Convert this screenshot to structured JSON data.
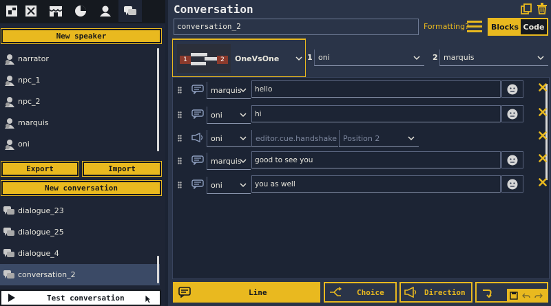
{
  "sidebar": {
    "tabs": [
      {
        "icon": "scene-icon"
      },
      {
        "icon": "map-icon"
      },
      {
        "icon": "shop-icon"
      },
      {
        "icon": "pie-chart-icon"
      },
      {
        "icon": "user-icon"
      },
      {
        "icon": "chat-icon"
      }
    ],
    "new_speaker_label": "New speaker",
    "speakers": [
      "narrator",
      "npc_1",
      "npc_2",
      "marquis",
      "oni"
    ],
    "export_label": "Export",
    "import_label": "Import",
    "new_conversation_label": "New conversation",
    "conversations": [
      "dialogue_23",
      "dialogue_25",
      "dialogue_4",
      "conversation_2"
    ],
    "selected_conversation": "conversation_2",
    "test_label": "Test conversation"
  },
  "main": {
    "title": "Conversation",
    "name_value": "conversation_2",
    "formatting_label": "Formatting?",
    "view_blocks_label": "Blocks",
    "view_code_label": "Code",
    "layout": {
      "name": "OneVsOne",
      "slot1_number": "1",
      "slot2_number": "2",
      "slot1_label": "1",
      "slot1_value": "oni",
      "slot2_label": "2",
      "slot2_value": "marquis"
    },
    "lines": [
      {
        "type": "speech",
        "speaker": "marquis",
        "text": "hello"
      },
      {
        "type": "speech",
        "speaker": "oni",
        "text": "hi"
      },
      {
        "type": "cue",
        "speaker": "oni",
        "cue": "editor.cue.handshake",
        "position": "Position 2"
      },
      {
        "type": "speech",
        "speaker": "marquis",
        "text": "good to see you"
      },
      {
        "type": "speech",
        "speaker": "oni",
        "text": "you as well"
      }
    ],
    "add_line_label": "Line",
    "add_choice_label": "Choice",
    "add_direction_label": "Direction"
  },
  "colors": {
    "accent": "#e9b91f",
    "panel": "#2a3448",
    "sidebar": "#1e2535",
    "danger_icon": "#e9b91f"
  }
}
